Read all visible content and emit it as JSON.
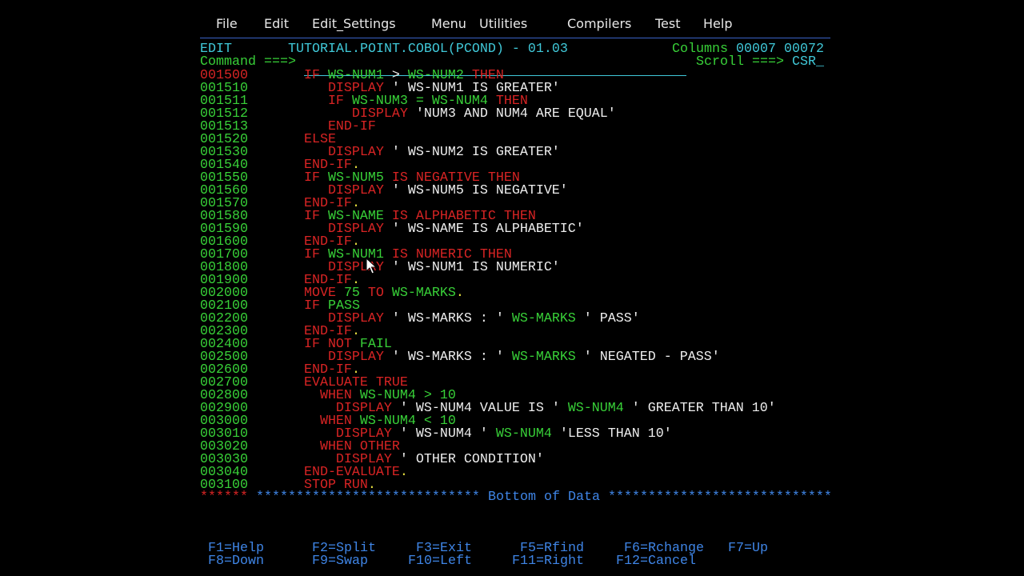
{
  "menu": [
    "File",
    "Edit",
    "Edit_Settings",
    "Menu",
    "Utilities",
    "Compilers",
    "Test",
    "Help"
  ],
  "header": {
    "mode": "EDIT",
    "dataset": "TUTORIAL.POINT.COBOL(PCOND) - 01.03",
    "columns_label": "Columns",
    "columns_values": "00007 00072",
    "command_label": "Command ===>",
    "command_value": "",
    "scroll_label": "Scroll ===>",
    "scroll_value": "CSR_"
  },
  "code": {
    "lines": [
      {
        "num": "001500",
        "current": true,
        "segs": [
          {
            "c": "r",
            "t": "       IF "
          },
          {
            "c": "g",
            "t": "WS-NUM1"
          },
          {
            "c": "w",
            "t": " > "
          },
          {
            "c": "g",
            "t": "WS-NUM2"
          },
          {
            "c": "r",
            "t": " THEN"
          }
        ]
      },
      {
        "num": "001510",
        "segs": [
          {
            "c": "r",
            "t": "          DISPLAY"
          },
          {
            "c": "w",
            "t": " ' WS-NUM1 IS GREATER'"
          }
        ]
      },
      {
        "num": "001511",
        "segs": [
          {
            "c": "r",
            "t": "          IF "
          },
          {
            "c": "g",
            "t": "WS-NUM3 = WS-NUM4"
          },
          {
            "c": "r",
            "t": " THEN"
          }
        ]
      },
      {
        "num": "001512",
        "segs": [
          {
            "c": "r",
            "t": "             DISPLAY"
          },
          {
            "c": "w",
            "t": " 'NUM3 AND NUM4 ARE EQUAL'"
          }
        ]
      },
      {
        "num": "001513",
        "segs": [
          {
            "c": "r",
            "t": "          END-IF"
          }
        ]
      },
      {
        "num": "001520",
        "segs": [
          {
            "c": "r",
            "t": "       ELSE"
          }
        ]
      },
      {
        "num": "001530",
        "segs": [
          {
            "c": "r",
            "t": "          DISPLAY"
          },
          {
            "c": "w",
            "t": " ' WS-NUM2 IS GREATER'"
          }
        ]
      },
      {
        "num": "001540",
        "segs": [
          {
            "c": "r",
            "t": "       END-IF"
          },
          {
            "c": "y",
            "t": "."
          }
        ]
      },
      {
        "num": "001550",
        "segs": [
          {
            "c": "r",
            "t": "       IF "
          },
          {
            "c": "g",
            "t": "WS-NUM5"
          },
          {
            "c": "r",
            "t": " IS NEGATIVE THEN"
          }
        ]
      },
      {
        "num": "001560",
        "segs": [
          {
            "c": "r",
            "t": "          DISPLAY"
          },
          {
            "c": "w",
            "t": " ' WS-NUM5 IS NEGATIVE'"
          }
        ]
      },
      {
        "num": "001570",
        "segs": [
          {
            "c": "r",
            "t": "       END-IF"
          },
          {
            "c": "y",
            "t": "."
          }
        ]
      },
      {
        "num": "001580",
        "segs": [
          {
            "c": "r",
            "t": "       IF "
          },
          {
            "c": "g",
            "t": "WS-NAME"
          },
          {
            "c": "r",
            "t": " IS ALPHABETIC THEN"
          }
        ]
      },
      {
        "num": "001590",
        "segs": [
          {
            "c": "r",
            "t": "          DISPLAY"
          },
          {
            "c": "w",
            "t": " ' WS-NAME IS ALPHABETIC'"
          }
        ]
      },
      {
        "num": "001600",
        "segs": [
          {
            "c": "r",
            "t": "       END-IF"
          },
          {
            "c": "y",
            "t": "."
          }
        ]
      },
      {
        "num": "001700",
        "segs": [
          {
            "c": "r",
            "t": "       IF "
          },
          {
            "c": "g",
            "t": "WS-NUM1"
          },
          {
            "c": "r",
            "t": " IS NUMERIC THEN"
          }
        ]
      },
      {
        "num": "001800",
        "segs": [
          {
            "c": "r",
            "t": "          DISPLAY"
          },
          {
            "c": "w",
            "t": " ' WS-NUM1 IS NUMERIC'"
          }
        ]
      },
      {
        "num": "001900",
        "segs": [
          {
            "c": "r",
            "t": "       END-IF"
          },
          {
            "c": "y",
            "t": "."
          }
        ]
      },
      {
        "num": "002000",
        "segs": [
          {
            "c": "r",
            "t": "       MOVE "
          },
          {
            "c": "g",
            "t": "75"
          },
          {
            "c": "r",
            "t": " TO "
          },
          {
            "c": "g",
            "t": "WS-MARKS"
          },
          {
            "c": "y",
            "t": "."
          }
        ]
      },
      {
        "num": "002100",
        "segs": [
          {
            "c": "r",
            "t": "       IF "
          },
          {
            "c": "g",
            "t": "PASS"
          }
        ]
      },
      {
        "num": "002200",
        "segs": [
          {
            "c": "r",
            "t": "          DISPLAY"
          },
          {
            "c": "w",
            "t": " ' WS-MARKS : ' "
          },
          {
            "c": "g",
            "t": "WS-MARKS"
          },
          {
            "c": "w",
            "t": " ' PASS'"
          }
        ]
      },
      {
        "num": "002300",
        "segs": [
          {
            "c": "r",
            "t": "       END-IF"
          },
          {
            "c": "y",
            "t": "."
          }
        ]
      },
      {
        "num": "002400",
        "segs": [
          {
            "c": "r",
            "t": "       IF NOT "
          },
          {
            "c": "g",
            "t": "FAIL"
          }
        ]
      },
      {
        "num": "002500",
        "segs": [
          {
            "c": "r",
            "t": "          DISPLAY"
          },
          {
            "c": "w",
            "t": " ' WS-MARKS : ' "
          },
          {
            "c": "g",
            "t": "WS-MARKS"
          },
          {
            "c": "w",
            "t": " ' NEGATED - PASS'"
          }
        ]
      },
      {
        "num": "002600",
        "segs": [
          {
            "c": "r",
            "t": "       END-IF"
          },
          {
            "c": "y",
            "t": "."
          }
        ]
      },
      {
        "num": "002700",
        "segs": [
          {
            "c": "r",
            "t": "       EVALUATE TRUE"
          }
        ]
      },
      {
        "num": "002800",
        "segs": [
          {
            "c": "r",
            "t": "         WHEN "
          },
          {
            "c": "g",
            "t": "WS-NUM4 > 10"
          }
        ]
      },
      {
        "num": "002900",
        "segs": [
          {
            "c": "r",
            "t": "           DISPLAY"
          },
          {
            "c": "w",
            "t": " ' WS-NUM4 VALUE IS ' "
          },
          {
            "c": "g",
            "t": "WS-NUM4"
          },
          {
            "c": "w",
            "t": " ' GREATER THAN 10'"
          }
        ]
      },
      {
        "num": "003000",
        "segs": [
          {
            "c": "r",
            "t": "         WHEN "
          },
          {
            "c": "g",
            "t": "WS-NUM4 < 10"
          }
        ]
      },
      {
        "num": "003010",
        "segs": [
          {
            "c": "r",
            "t": "           DISPLAY"
          },
          {
            "c": "w",
            "t": " ' WS-NUM4 ' "
          },
          {
            "c": "g",
            "t": "WS-NUM4"
          },
          {
            "c": "w",
            "t": " 'LESS THAN 10'"
          }
        ]
      },
      {
        "num": "003020",
        "segs": [
          {
            "c": "r",
            "t": "         WHEN OTHER"
          }
        ]
      },
      {
        "num": "003030",
        "segs": [
          {
            "c": "r",
            "t": "           DISPLAY"
          },
          {
            "c": "w",
            "t": " ' OTHER CONDITION'"
          }
        ]
      },
      {
        "num": "003040",
        "segs": [
          {
            "c": "r",
            "t": "       END-EVALUATE"
          },
          {
            "c": "y",
            "t": "."
          }
        ]
      },
      {
        "num": "003100",
        "segs": [
          {
            "c": "r",
            "t": "       STOP RUN"
          },
          {
            "c": "y",
            "t": "."
          }
        ]
      }
    ],
    "bottom_prefix": "******",
    "bottom_stars_left": "****************************",
    "bottom_label": "Bottom of Data",
    "bottom_stars_right": "****************************"
  },
  "fkeys": {
    "row1": [
      "F1=Help",
      "F2=Split",
      "F3=Exit",
      "F5=Rfind",
      "F6=Rchange",
      "F7=Up"
    ],
    "row2": [
      "F8=Down",
      "F9=Swap",
      "F10=Left",
      "F11=Right",
      "F12=Cancel"
    ]
  },
  "colors": {
    "keyword": "#d82424",
    "identifier": "#38d038",
    "literal": "#eeeeee",
    "title": "#40c8d8",
    "info": "#3f85e6",
    "period": "#e8e040"
  },
  "icons": {
    "pointer": "mouse-pointer-icon"
  }
}
